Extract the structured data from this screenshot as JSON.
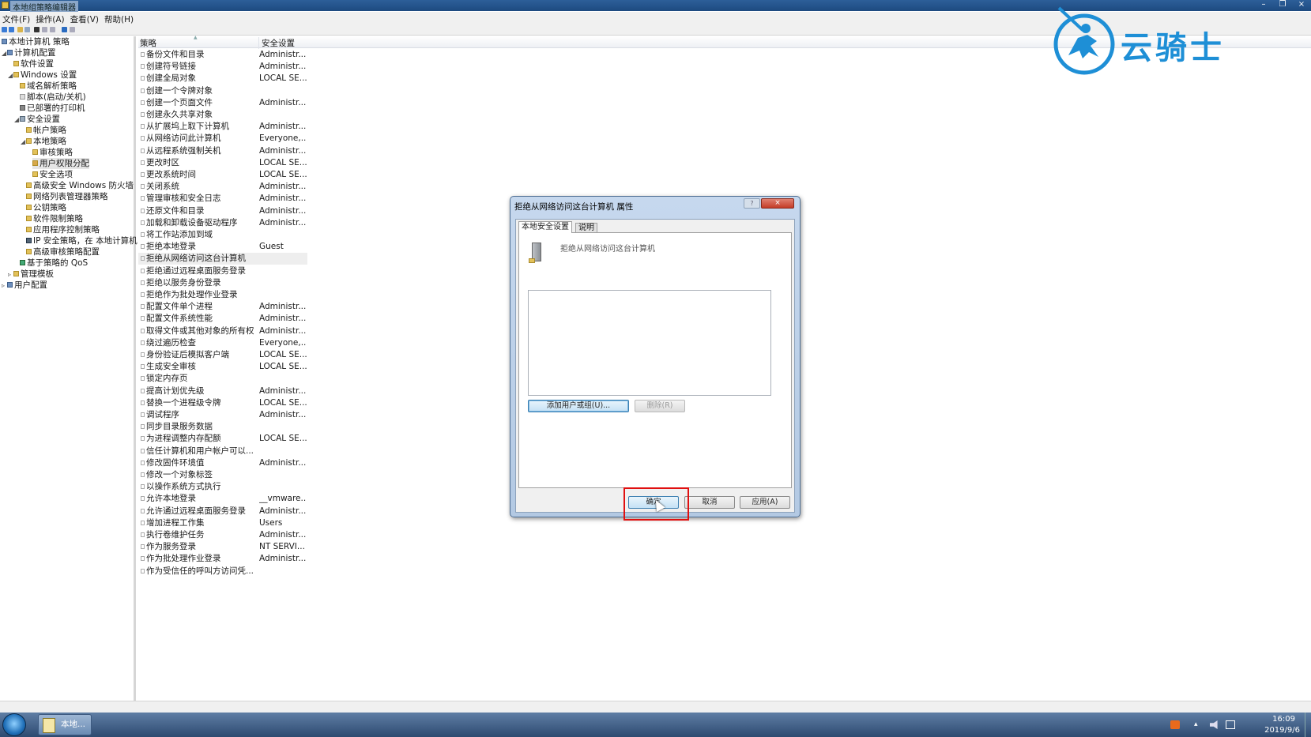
{
  "window": {
    "title": "本地组策略编辑器",
    "controls": [
      "–",
      "❐",
      "×"
    ]
  },
  "menu": [
    "文件(F)",
    "操作(A)",
    "查看(V)",
    "帮助(H)"
  ],
  "tree": [
    {
      "label": "本地计算机 策略",
      "icon": "computer-icon"
    },
    {
      "label": "计算机配置",
      "icon": "computer-icon"
    },
    {
      "label": "软件设置",
      "icon": "folder-icon"
    },
    {
      "label": "Windows 设置",
      "icon": "folder-icon"
    },
    {
      "label": "域名解析策略",
      "icon": "folder-icon"
    },
    {
      "label": "脚本(启动/关机)",
      "icon": "script-icon"
    },
    {
      "label": "已部署的打印机",
      "icon": "printer-icon"
    },
    {
      "label": "安全设置",
      "icon": "shield-icon"
    },
    {
      "label": "帐户策略",
      "icon": "folder-icon"
    },
    {
      "label": "本地策略",
      "icon": "folder-icon"
    },
    {
      "label": "审核策略",
      "icon": "folder-icon"
    },
    {
      "label": "用户权限分配",
      "icon": "folder-icon"
    },
    {
      "label": "安全选项",
      "icon": "folder-icon"
    },
    {
      "label": "高级安全 Windows 防火墙",
      "icon": "folder-icon"
    },
    {
      "label": "网络列表管理器策略",
      "icon": "folder-icon"
    },
    {
      "label": "公钥策略",
      "icon": "folder-icon"
    },
    {
      "label": "软件限制策略",
      "icon": "folder-icon"
    },
    {
      "label": "应用程序控制策略",
      "icon": "folder-icon"
    },
    {
      "label": "IP 安全策略，在 本地计算机",
      "icon": "network-icon"
    },
    {
      "label": "高级审核策略配置",
      "icon": "folder-icon"
    },
    {
      "label": "基于策略的 QoS",
      "icon": "chart-icon"
    },
    {
      "label": "管理模板",
      "icon": "folder-icon"
    },
    {
      "label": "用户配置",
      "icon": "user-icon"
    }
  ],
  "list": {
    "headers": {
      "policy": "策略",
      "setting": "安全设置"
    },
    "selected_index": 17,
    "rows": [
      {
        "policy": "备份文件和目录",
        "setting": "Administr..."
      },
      {
        "policy": "创建符号链接",
        "setting": "Administr..."
      },
      {
        "policy": "创建全局对象",
        "setting": "LOCAL SE..."
      },
      {
        "policy": "创建一个令牌对象",
        "setting": ""
      },
      {
        "policy": "创建一个页面文件",
        "setting": "Administr..."
      },
      {
        "policy": "创建永久共享对象",
        "setting": ""
      },
      {
        "policy": "从扩展坞上取下计算机",
        "setting": "Administr..."
      },
      {
        "policy": "从网络访问此计算机",
        "setting": "Everyone,..."
      },
      {
        "policy": "从远程系统强制关机",
        "setting": "Administr..."
      },
      {
        "policy": "更改时区",
        "setting": "LOCAL SE..."
      },
      {
        "policy": "更改系统时间",
        "setting": "LOCAL SE..."
      },
      {
        "policy": "关闭系统",
        "setting": "Administr..."
      },
      {
        "policy": "管理审核和安全日志",
        "setting": "Administr..."
      },
      {
        "policy": "还原文件和目录",
        "setting": "Administr..."
      },
      {
        "policy": "加载和卸载设备驱动程序",
        "setting": "Administr..."
      },
      {
        "policy": "将工作站添加到域",
        "setting": ""
      },
      {
        "policy": "拒绝本地登录",
        "setting": "Guest"
      },
      {
        "policy": "拒绝从网络访问这台计算机",
        "setting": ""
      },
      {
        "policy": "拒绝通过远程桌面服务登录",
        "setting": ""
      },
      {
        "policy": "拒绝以服务身份登录",
        "setting": ""
      },
      {
        "policy": "拒绝作为批处理作业登录",
        "setting": ""
      },
      {
        "policy": "配置文件单个进程",
        "setting": "Administr..."
      },
      {
        "policy": "配置文件系统性能",
        "setting": "Administr..."
      },
      {
        "policy": "取得文件或其他对象的所有权",
        "setting": "Administr..."
      },
      {
        "policy": "绕过遍历检查",
        "setting": "Everyone,..."
      },
      {
        "policy": "身份验证后模拟客户端",
        "setting": "LOCAL SE..."
      },
      {
        "policy": "生成安全审核",
        "setting": "LOCAL SE..."
      },
      {
        "policy": "锁定内存页",
        "setting": ""
      },
      {
        "policy": "提高计划优先级",
        "setting": "Administr..."
      },
      {
        "policy": "替换一个进程级令牌",
        "setting": "LOCAL SE..."
      },
      {
        "policy": "调试程序",
        "setting": "Administr..."
      },
      {
        "policy": "同步目录服务数据",
        "setting": ""
      },
      {
        "policy": "为进程调整内存配额",
        "setting": "LOCAL SE..."
      },
      {
        "policy": "信任计算机和用户帐户可以...",
        "setting": ""
      },
      {
        "policy": "修改固件环境值",
        "setting": "Administr..."
      },
      {
        "policy": "修改一个对象标签",
        "setting": ""
      },
      {
        "policy": "以操作系统方式执行",
        "setting": ""
      },
      {
        "policy": "允许本地登录",
        "setting": "__vmware..."
      },
      {
        "policy": "允许通过远程桌面服务登录",
        "setting": "Administr..."
      },
      {
        "policy": "增加进程工作集",
        "setting": "Users"
      },
      {
        "policy": "执行卷维护任务",
        "setting": "Administr..."
      },
      {
        "policy": "作为服务登录",
        "setting": "NT SERVI..."
      },
      {
        "policy": "作为批处理作业登录",
        "setting": "Administr..."
      },
      {
        "policy": "作为受信任的呼叫方访问凭...",
        "setting": ""
      }
    ]
  },
  "dialog": {
    "title": "拒绝从网络访问这台计算机 属性",
    "help": "?",
    "close": "×",
    "tabs": [
      "本地安全设置",
      "说明"
    ],
    "policy_name": "拒绝从网络访问这台计算机",
    "add_button": "添加用户或组(U)...",
    "remove_button": "删除(R)",
    "ok_button": "确定",
    "cancel_button": "取消",
    "apply_button": "应用(A)"
  },
  "taskbar": {
    "task_label": "本地...",
    "time": "16:09",
    "date": "2019/9/6"
  },
  "watermark": {
    "text": "云骑士"
  },
  "colors": {
    "accent": "#1e8fd6",
    "highlight_box": "#e01010",
    "taskbar": "#2d4a70"
  }
}
